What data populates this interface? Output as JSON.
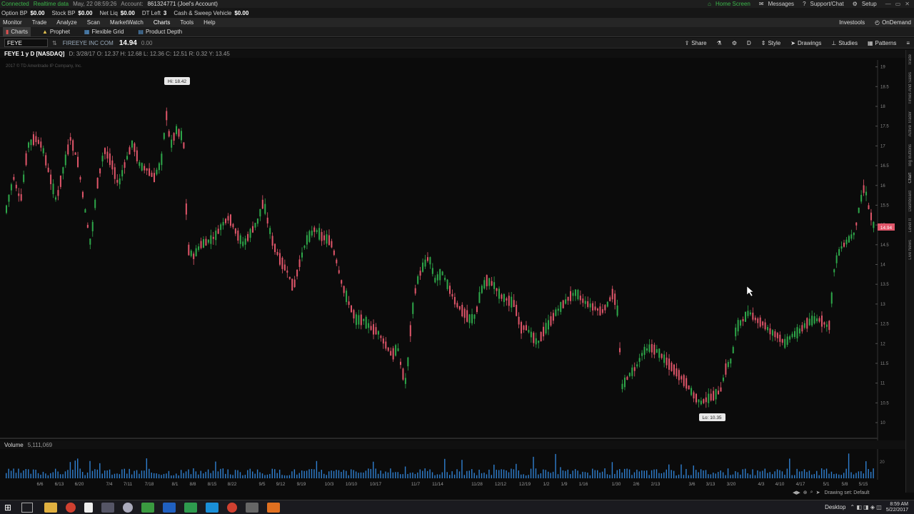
{
  "status": {
    "connected": "Connected",
    "realtime": "Realtime data",
    "datetime": "May, 22  08:59:26",
    "account_label": "Account:",
    "account_value": "861324771 (Joel's Account)",
    "right_items": [
      "Home Screen",
      "Messages",
      "Support/Chat",
      "Setup"
    ]
  },
  "account_bar": [
    {
      "label": "Option BP",
      "value": "$0.00"
    },
    {
      "label": "Stock BP",
      "value": "$0.00"
    },
    {
      "label": "Net Liq",
      "value": "$0.00"
    },
    {
      "label": "DT Left",
      "value": "3"
    },
    {
      "label": "Cash & Sweep Vehicle",
      "value": "$0.00"
    }
  ],
  "menu": [
    "Monitor",
    "Trade",
    "Analyze",
    "Scan",
    "MarketWatch",
    "Charts",
    "Tools",
    "Help"
  ],
  "menu_right": [
    "Investools",
    "OnDemand"
  ],
  "subtabs": [
    "Charts",
    "Prophet",
    "Flexible Grid",
    "Product Depth"
  ],
  "symbol": {
    "ticker": "FEYE",
    "company": "FIREEYE INC COM",
    "price": "14.94",
    "change": "0.00"
  },
  "toolbar": [
    "Share",
    "D",
    "Style",
    "Drawings",
    "Studies",
    "Patterns"
  ],
  "chart_header": {
    "title": "FEYE 1 y D [NASDAQ]",
    "ohlc": "D: 3/28/17  O: 12.37  H: 12.68  L: 12.36  C: 12.51  R: 0.32  Y: 13.45"
  },
  "copyright": "2017 © TD Ameritrade IP Company, Inc.",
  "price_axis": [
    "19",
    "18.5",
    "18",
    "17.5",
    "17",
    "16.5",
    "16",
    "15.5",
    "15",
    "14.5",
    "14",
    "13.5",
    "13",
    "12.5",
    "12",
    "11.5",
    "11",
    "10.5",
    "10"
  ],
  "date_axis": [
    "6/6",
    "6/13",
    "6/20",
    "7/4",
    "7/11",
    "7/18",
    "8/1",
    "8/8",
    "8/15",
    "8/22",
    "9/5",
    "9/12",
    "9/19",
    "10/3",
    "10/10",
    "10/17",
    "11/7",
    "11/14",
    "11/28",
    "12/12",
    "12/19",
    "1/2",
    "1/9",
    "1/16",
    "1/30",
    "2/6",
    "2/13",
    "3/6",
    "3/13",
    "3/20",
    "4/3",
    "4/10",
    "4/17",
    "5/1",
    "5/8",
    "5/15"
  ],
  "hi_label": "Hi: 18.42",
  "lo_label": "Lo: 10.35",
  "last_price_tag": "14.94",
  "volume": {
    "label": "Volume",
    "value": "5,111,069",
    "axis_label": "20"
  },
  "right_sidebar": [
    "Trade",
    "Times And Sales",
    "Active Trader",
    "Big Buttons",
    "Chart",
    "Dashboard",
    "Level II",
    "Live News"
  ],
  "drawing_set": "Drawing set: Default",
  "taskbar": {
    "desktop": "Desktop",
    "time": "8:59 AM",
    "date": "5/22/2017"
  },
  "colors": {
    "up": "#2ea84a",
    "down": "#e0566a",
    "bg": "#0b0b0b",
    "accent": "#3b7bd8"
  },
  "chart_data": {
    "type": "candlestick",
    "title": "FEYE 1 y D [NASDAQ]",
    "ylim": [
      10,
      19
    ],
    "path": [
      [
        0,
        14.0
      ],
      [
        8,
        15.4
      ],
      [
        18,
        16.2
      ],
      [
        28,
        15.6
      ],
      [
        38,
        17.0
      ],
      [
        48,
        17.2
      ],
      [
        58,
        17.0
      ],
      [
        68,
        16.3
      ],
      [
        78,
        15.6
      ],
      [
        85,
        16.2
      ],
      [
        98,
        17.2
      ],
      [
        108,
        16.6
      ],
      [
        118,
        15.4
      ],
      [
        126,
        14.5
      ],
      [
        135,
        16.0
      ],
      [
        145,
        16.9
      ],
      [
        155,
        16.6
      ],
      [
        165,
        16.0
      ],
      [
        175,
        16.6
      ],
      [
        185,
        17.1
      ],
      [
        195,
        16.5
      ],
      [
        205,
        16.4
      ],
      [
        215,
        16.2
      ],
      [
        225,
        16.6
      ],
      [
        232,
        17.8
      ],
      [
        238,
        17.0
      ],
      [
        246,
        17.4
      ],
      [
        256,
        17.2
      ],
      [
        262,
        14.4
      ],
      [
        270,
        14.2
      ],
      [
        280,
        14.5
      ],
      [
        292,
        14.6
      ],
      [
        300,
        14.7
      ],
      [
        310,
        15.0
      ],
      [
        320,
        15.2
      ],
      [
        330,
        14.8
      ],
      [
        340,
        14.5
      ],
      [
        350,
        14.8
      ],
      [
        360,
        15.1
      ],
      [
        368,
        15.6
      ],
      [
        375,
        15.0
      ],
      [
        382,
        14.5
      ],
      [
        392,
        14.1
      ],
      [
        402,
        13.8
      ],
      [
        410,
        13.4
      ],
      [
        418,
        14.0
      ],
      [
        428,
        14.6
      ],
      [
        440,
        14.9
      ],
      [
        450,
        14.7
      ],
      [
        462,
        14.6
      ],
      [
        470,
        14.1
      ],
      [
        478,
        13.5
      ],
      [
        488,
        13.0
      ],
      [
        498,
        12.6
      ],
      [
        508,
        12.6
      ],
      [
        518,
        12.4
      ],
      [
        528,
        12.3
      ],
      [
        538,
        12.0
      ],
      [
        548,
        11.7
      ],
      [
        556,
        11.9
      ],
      [
        562,
        11.3
      ],
      [
        568,
        11.0
      ],
      [
        575,
        12.6
      ],
      [
        582,
        13.5
      ],
      [
        590,
        13.9
      ],
      [
        600,
        14.2
      ],
      [
        608,
        13.6
      ],
      [
        618,
        13.8
      ],
      [
        628,
        13.4
      ],
      [
        638,
        13.0
      ],
      [
        648,
        12.8
      ],
      [
        658,
        12.6
      ],
      [
        665,
        12.7
      ],
      [
        672,
        13.3
      ],
      [
        680,
        13.6
      ],
      [
        690,
        13.5
      ],
      [
        700,
        13.2
      ],
      [
        710,
        13.1
      ],
      [
        720,
        13.0
      ],
      [
        728,
        12.4
      ],
      [
        736,
        12.4
      ],
      [
        744,
        12.2
      ],
      [
        752,
        12.0
      ],
      [
        760,
        12.3
      ],
      [
        768,
        12.5
      ],
      [
        778,
        12.8
      ],
      [
        788,
        13.0
      ],
      [
        798,
        13.2
      ],
      [
        806,
        13.3
      ],
      [
        814,
        13.1
      ],
      [
        822,
        13.0
      ],
      [
        832,
        12.9
      ],
      [
        842,
        12.8
      ],
      [
        850,
        13.0
      ],
      [
        858,
        13.3
      ],
      [
        864,
        12.8
      ],
      [
        870,
        10.9
      ],
      [
        880,
        11.2
      ],
      [
        890,
        11.4
      ],
      [
        900,
        11.8
      ],
      [
        910,
        11.9
      ],
      [
        920,
        11.8
      ],
      [
        930,
        11.6
      ],
      [
        940,
        11.4
      ],
      [
        950,
        11.2
      ],
      [
        960,
        11.0
      ],
      [
        970,
        10.7
      ],
      [
        980,
        10.5
      ],
      [
        990,
        10.6
      ],
      [
        1000,
        10.7
      ],
      [
        1008,
        10.8
      ],
      [
        1016,
        11.4
      ],
      [
        1024,
        11.6
      ],
      [
        1030,
        12.4
      ],
      [
        1040,
        12.6
      ],
      [
        1048,
        12.8
      ],
      [
        1058,
        12.6
      ],
      [
        1068,
        12.5
      ],
      [
        1078,
        12.3
      ],
      [
        1088,
        12.2
      ],
      [
        1098,
        12.0
      ],
      [
        1108,
        12.2
      ],
      [
        1118,
        12.3
      ],
      [
        1128,
        12.5
      ],
      [
        1138,
        12.6
      ],
      [
        1148,
        12.6
      ],
      [
        1160,
        12.4
      ],
      [
        1168,
        14.0
      ],
      [
        1176,
        14.4
      ],
      [
        1186,
        14.6
      ],
      [
        1196,
        14.8
      ],
      [
        1204,
        15.6
      ],
      [
        1210,
        16.0
      ],
      [
        1216,
        15.4
      ],
      [
        1224,
        14.9
      ]
    ]
  }
}
